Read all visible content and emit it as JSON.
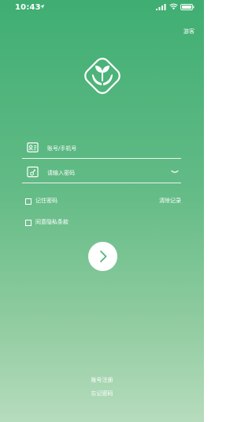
{
  "status_bar": {
    "time": "10:43",
    "icons": [
      "location-arrow-icon",
      "signal-icon",
      "wifi-icon",
      "battery-icon"
    ]
  },
  "header": {
    "guest_label": "游客"
  },
  "logo": {
    "icon": "hands-sprout-logo-icon"
  },
  "form": {
    "account_placeholder": "账号/手机号",
    "password_placeholder": "请输入密码",
    "remember_label": "记住密码",
    "clear_label": "清除记录",
    "agree_label": "同意隐私条款",
    "submit_icon": "arrow-right-icon"
  },
  "footer": {
    "register_label": "账号注册",
    "forgot_label": "忘记密码"
  },
  "colors": {
    "gradient_top": "#3fae72",
    "gradient_bottom": "#b6dcbd",
    "foreground": "#ffffff",
    "arrow": "#4bb378"
  }
}
